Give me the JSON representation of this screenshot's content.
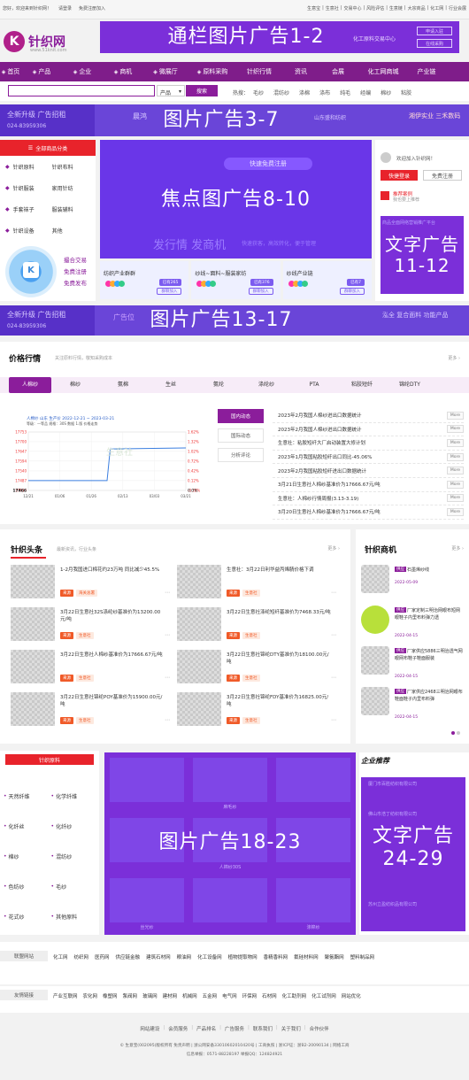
{
  "topbar": {
    "left": [
      "您好，欢迎来到针织网！",
      "请登录",
      "免费注册加入"
    ],
    "right": [
      "生意宝",
      "生意社",
      "交易中心",
      "风险评估",
      "生意链",
      "大宗商品",
      "化工网",
      "行业会展"
    ]
  },
  "logo": {
    "mark": "K",
    "name": "针织网",
    "url": "www.51knit.com"
  },
  "ads": {
    "banner_1_2": "通栏图片广告1-2",
    "pic_3_7": "图片广告3-7",
    "focus_8_10": "焦点图广告8-10",
    "text_11_12": "文字广告\n11-12",
    "pic_13_17": "图片广告13-17",
    "pic_18_23": "图片广告18-23",
    "text_24_29": "文字广告\n24-29",
    "banner_bg_title": "化工原料交易中心",
    "banner_btn1": "申请入驻",
    "banner_btn2": "在线采购",
    "strip_text1": "全新升级 广告招租",
    "strip_text2": "024-83959306",
    "strip_brand1": "晨鸿",
    "strip_brand2": "山东盛和纺织",
    "strip_brand3": "湘伊实业 三禾数码",
    "strip2_text": "广告位",
    "strip2_brand": "泓全 复合面料 功能产品"
  },
  "nav": {
    "items": [
      "首页",
      "产品",
      "企业",
      "商机",
      "微展厅",
      "原料采购",
      "针织行情",
      "资讯",
      "会展",
      "化工网商城",
      "产业链"
    ]
  },
  "search": {
    "placeholder": "",
    "select": "产品",
    "button": "搜索",
    "hot_label": "热搜：",
    "hot": [
      "毛纱",
      "混纺纱",
      "涤棉",
      "涤布",
      "纯毛",
      "经编",
      "棉纱",
      "粘胶"
    ]
  },
  "category": {
    "header": "全部商品分类",
    "items": [
      [
        "针织原料",
        "针织布料"
      ],
      [
        "针织服装",
        "家用针纺"
      ],
      [
        "手套袜子",
        "服装辅料"
      ],
      [
        "针织设备",
        "其他"
      ]
    ],
    "qr_actions": [
      "撮合交易",
      "免费注册",
      "免费发布"
    ]
  },
  "focus": {
    "btn": "快速免费注册",
    "slogan": "发行情 发商机",
    "slogan2": "快速获客，高效转化，便于管理",
    "cards": [
      {
        "title": "纺织产业群群",
        "badge": "已有265",
        "btn": "群聊加入"
      },
      {
        "title": "纱线~面料~服装家纺",
        "badge": "已有376",
        "btn": "群聊加入"
      },
      {
        "title": "纱线产业链",
        "badge": "已有7",
        "btn": "群聊加入"
      }
    ]
  },
  "user": {
    "welcome": "欢迎加入针织网！",
    "login": "快捷登录",
    "register": "免费注册",
    "recommend": "推荐案例",
    "recommend_sub": "我也要上推荐",
    "side_text": "商品全面网络营销推广平台"
  },
  "price": {
    "title": "价格行情",
    "subtitle": "关注原料行情，敬知采购成本",
    "more": "更多",
    "tabs": [
      "人棉纱",
      "棉纱",
      "氨棉",
      "生丝",
      "氨纶",
      "涤纶纱",
      "PTA",
      "粘胶短纤",
      "锦纶DTY"
    ],
    "chart_title": "人棉纱 山东 生产价 2022-12-21 ~ 2023-03-21",
    "chart_sub": "等级：一等品 规格：30S 数据 1.版 价格走势",
    "watermark": "生意社",
    "subtabs": [
      "国内动态",
      "国际动态",
      "分析评论"
    ],
    "news": [
      "2023年2月我国人棉纱进出口数据统计",
      "2023年2月我国人棉纱进出口数据统计",
      "生意社：粘胶短纤大厂启动装置大修计划",
      "2023年1月我国粘胶短纤出口同比-45.06%",
      "2023年2月我国粘胶短纤进出口数据统计",
      "3月21日生意社人棉纱基准价为17666.67元/吨",
      "生意社：人棉纱行情周报(3.13-3.19)",
      "3月20日生意社人棉纱基准价为17666.67元/吨"
    ],
    "news_more": "More"
  },
  "chart_data": {
    "type": "line",
    "title": "人棉纱 山东 生产价 2022-12-21 ~ 2023-03-21",
    "x": [
      "12/21",
      "01/06",
      "01/26",
      "02/13",
      "03/03",
      "03/21"
    ],
    "xlabel": "",
    "ylabel": "",
    "ylim": [
      17433,
      17753
    ],
    "yticks": [
      17753,
      17700,
      17647,
      17594,
      17540,
      17487,
      17433
    ],
    "yticks_right": [
      "1.62%",
      "1.32%",
      "1.02%",
      "0.72%",
      "0.42%",
      "0.12%",
      "-0.18%"
    ],
    "series": [
      {
        "name": "",
        "points": [
          [
            0,
            17487
          ],
          [
            0.5,
            17487
          ],
          [
            0.52,
            17660
          ],
          [
            1.0,
            17666
          ]
        ]
      }
    ],
    "current_value": "17466",
    "current_pct": "0.0%",
    "grid": true
  },
  "headlines": {
    "title": "针织头条",
    "subtitle": "最新资讯，行业头条",
    "more": "更多",
    "items": [
      {
        "text": "1-2月我国进口棉花约23万吨 同比减少45.5%",
        "tags": [
          "来源",
          "海关总署"
        ]
      },
      {
        "text": "生意社：3月22日利华益丙烯腈价格下调",
        "tags": [
          "来源",
          "生意社"
        ]
      },
      {
        "text": "3月22日生意社32S涤纶纱基准价为13200.00元/吨",
        "tags": [
          "来源",
          "生意社"
        ]
      },
      {
        "text": "3月22日生意社涤纶短纤基准价为7468.33元/吨",
        "tags": [
          "来源",
          "生意社"
        ]
      },
      {
        "text": "3月22日生意社人棉纱基准价为17666.67元/吨",
        "tags": [
          "来源",
          "生意社"
        ]
      },
      {
        "text": "3月22日生意社锦纶DTY基准价为18100.00元/吨",
        "tags": [
          "来源",
          "生意社"
        ]
      },
      {
        "text": "3月22日生意社锦纶POY基准价为15900.00元/吨",
        "tags": [
          "来源",
          "生意社"
        ]
      },
      {
        "text": "3月22日生意社锦纶FDY基准价为16825.00元/吨",
        "tags": [
          "来源",
          "生意社"
        ]
      }
    ]
  },
  "opps": {
    "title": "针织商机",
    "more": "更多",
    "items": [
      {
        "tag": "供应",
        "text": "石墨烯纱线",
        "date": "2022-05-09"
      },
      {
        "tag": "供应",
        "text": "厂家定制三明治网眼布短网眼鞋子内里布料弹力透",
        "date": "2022-04-15"
      },
      {
        "tag": "供应",
        "text": "厂家供应5886三明治透气网眼网布鞋子鞋面服装",
        "date": "2022-04-15"
      },
      {
        "tag": "供应",
        "text": "厂家供应2468三明治网眼布鞋面鞋子内里布料弹",
        "date": "2022-04-15"
      }
    ]
  },
  "raw": {
    "header": "针织原料",
    "items": [
      [
        "天然纤维",
        "化学纤维"
      ],
      [
        "化纤丝",
        "化纤纱"
      ],
      [
        "棉纱",
        "混纺纱"
      ],
      [
        "色纺纱",
        "毛纱"
      ],
      [
        "花式纱",
        "其他原料"
      ]
    ]
  },
  "products": [
    "",
    "麻毛纱",
    "",
    "",
    "人棉纱30S",
    "",
    "丝光纱",
    "",
    "涤棉纱"
  ],
  "enterprise": {
    "title": "企业推荐",
    "items": [
      "厦门市百胜纺织有限公司",
      "佛山市浩丁纺织有限公司",
      "",
      "",
      "苏州立盈纺织品有限公司"
    ]
  },
  "links1": {
    "label": "联盟网站",
    "items": [
      "化工网",
      "纺织网",
      "医药网",
      "供应链金融",
      "建筑石材网",
      "粮油网",
      "化工设备网",
      "植物提取物网",
      "香精香料网",
      "氟硅材料网",
      "聚氨酯网",
      "塑料制品网"
    ]
  },
  "links2": {
    "label": "友情链接",
    "items": [
      "产业互联网",
      "农化网",
      "橡塑网",
      "泵阀网",
      "玻璃网",
      "建材网",
      "机械网",
      "五金网",
      "电气网",
      "环保网",
      "石材网",
      "化工助剂网",
      "化工试剂网",
      "网站优化"
    ]
  },
  "footer": {
    "links": [
      "网站建设",
      "会员服务",
      "产品排名",
      "广告服务",
      "联系我们",
      "关于我们",
      "合作伙伴"
    ],
    "copyright": "© 生意宝(002095)版权所有  免责声明 | 浙公网安备33010602010420号 | 工商执照 | 浙ICP证：浙B2-20090134 | 网络工商",
    "contact": "信息举报：0571-88228197  举报QQ：124824921"
  },
  "colors": {
    "brand": "#7f1d8a",
    "ad": "#7b2fd9",
    "accent": "#e8232b"
  }
}
